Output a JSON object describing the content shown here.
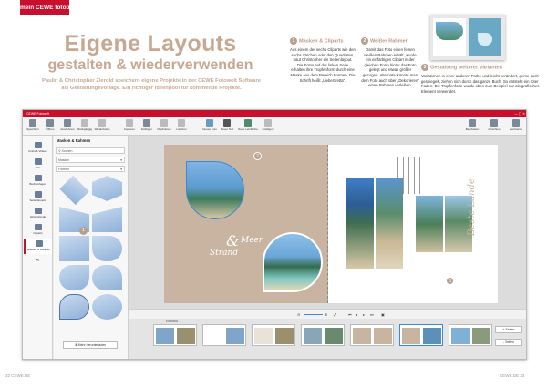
{
  "logo": {
    "text": "mein CEWE fotobuch"
  },
  "headline": {
    "line1": "Eigene Layouts",
    "line2": "gestalten & wiederverwenden"
  },
  "intro": "Paulin & Christopher Zierold speichern eigene Projekte in der CEWE Fotowelt Software als Gestaltungsvorlage. Ein richtiger Ideenpool für kommende Projekte.",
  "steps": [
    {
      "num": "1",
      "title": "Masken & Cliparts",
      "text": "Aus einem der sechs Cliparts wie den sechs Strichen oder den Quadraten, baut Christopher ein Seitenlayout. Die Fotos auf der linken Seite erhalten ihre Tropfenform durch eine Maske aus dem Bereich Formen. Die Schrift heißt „LiebeGretta“."
    },
    {
      "num": "2",
      "title": "Weißer Rahmen",
      "text": "Damit das Foto einen feinen weißen Rahmen erhält, wurde ein einfarbiges Clipart in der gleichen Form hinter das Foto gelegt und etwas größer gezogen. Alternativ könnte man dem Foto auch über „Dekorieren“ einen Rahmen verleihen."
    },
    {
      "num": "3",
      "title": "Gestaltung weiterer Varianten",
      "text": "Variationen in einer anderen Farbe und leicht verändert, gerne auch gespiegelt, ziehen sich durch das ganze Buch. So entsteht ein roter Faden. Die Tropfenform wurde oben zum Beispiel nur als grafisches Element verwendet."
    }
  ],
  "app": {
    "title": "CEWE Fotowelt",
    "toolbar": [
      "Speichern",
      "Öffnen",
      "Ausdehnen",
      "Rückgängig",
      "Wiederholen",
      "Kopieren",
      "Einfügen",
      "Duplizieren",
      "Löschen",
      "Neues Foto",
      "Neuer Text",
      "Neue Leinfläche",
      "Intelligent"
    ],
    "toolbar_right": [
      "Bearbeiten",
      "Ansichten",
      "Zentrieren"
    ],
    "sidebar": [
      "Fotos & Videos",
      "Stile",
      "Buchvorlagen",
      "Seitenlayouts",
      "Hintergründe",
      "Cliparts",
      "Masken & Rahmen"
    ],
    "panel": {
      "title": "Masken & Rahmen",
      "search_placeholder": "Suchen",
      "dropdown1": "Masken",
      "dropdown2": "Formen",
      "more_button": "Mehr herunterladen"
    },
    "page_text": {
      "strand": "Strand",
      "amp": "&",
      "meer": "Meer",
      "vertical": "Beste Lande"
    },
    "strip_buttons": [
      "+ Seiten",
      "- Seiten"
    ],
    "strip_label": "Einband"
  },
  "footer": {
    "left": "32 CEWE.DE",
    "right": "CEWE.DE 33"
  }
}
